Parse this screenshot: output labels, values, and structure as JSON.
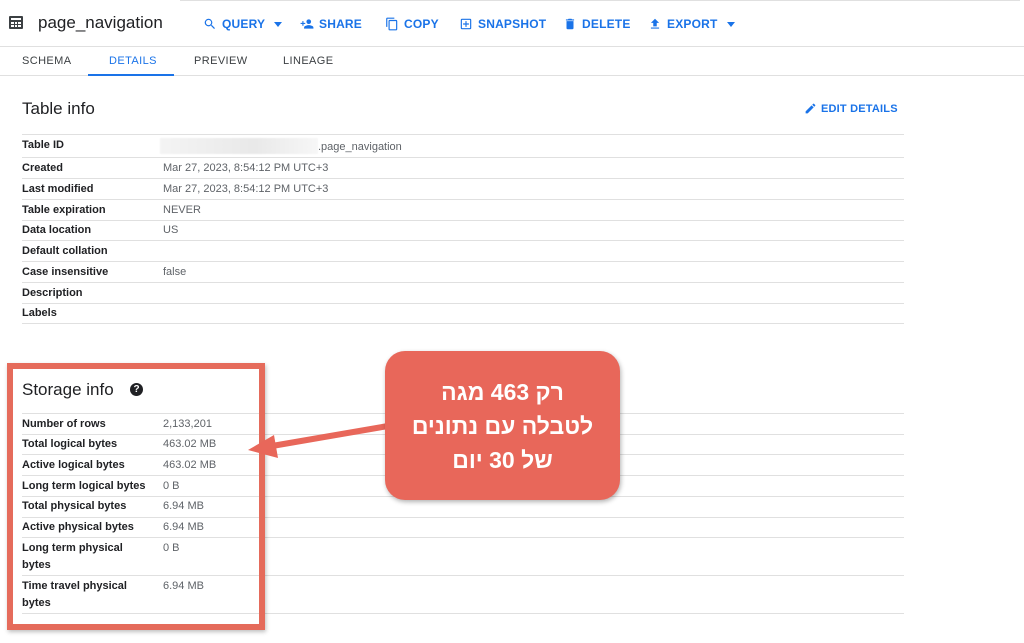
{
  "header": {
    "title": "page_navigation",
    "actions": {
      "query": "QUERY",
      "share": "SHARE",
      "copy": "COPY",
      "snapshot": "SNAPSHOT",
      "delete": "DELETE",
      "export": "EXPORT"
    }
  },
  "tabs": {
    "schema": "SCHEMA",
    "details": "DETAILS",
    "preview": "PREVIEW",
    "lineage": "LINEAGE",
    "active": "DETAILS"
  },
  "table_info": {
    "heading": "Table info",
    "edit_label": "EDIT DETAILS",
    "rows": [
      {
        "label": "Table ID",
        "value": ".page_navigation"
      },
      {
        "label": "Created",
        "value": "Mar 27, 2023, 8:54:12 PM UTC+3"
      },
      {
        "label": "Last modified",
        "value": "Mar 27, 2023, 8:54:12 PM UTC+3"
      },
      {
        "label": "Table expiration",
        "value": "NEVER"
      },
      {
        "label": "Data location",
        "value": "US"
      },
      {
        "label": "Default collation",
        "value": ""
      },
      {
        "label": "Case insensitive",
        "value": "false"
      },
      {
        "label": "Description",
        "value": ""
      },
      {
        "label": "Labels",
        "value": ""
      }
    ]
  },
  "storage_info": {
    "heading": "Storage info",
    "rows": [
      {
        "label": "Number of rows",
        "value": "2,133,201"
      },
      {
        "label": "Total logical bytes",
        "value": "463.02 MB"
      },
      {
        "label": "Active logical bytes",
        "value": "463.02 MB"
      },
      {
        "label": "Long term logical bytes",
        "value": "0 B"
      },
      {
        "label": "Total physical bytes",
        "value": "6.94 MB"
      },
      {
        "label": "Active physical bytes",
        "value": "6.94 MB"
      },
      {
        "label": "Long term physical bytes",
        "value": "0 B"
      },
      {
        "label": "Time travel physical bytes",
        "value": "6.94 MB"
      }
    ]
  },
  "annotation": {
    "lines": [
      "רק 463 מגה",
      "לטבלה עם נתונים",
      "של 30 יום"
    ],
    "color": "#e8675a"
  },
  "colors": {
    "accent": "#1a73e8",
    "highlight": "#e56b5b"
  }
}
